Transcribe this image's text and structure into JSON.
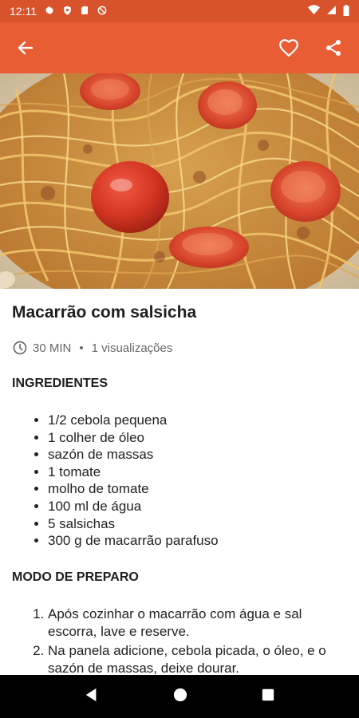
{
  "status_bar": {
    "time": "12:11",
    "icons": [
      "settings-icon",
      "shield-icon",
      "sd-card-icon",
      "no-sync-icon",
      "wifi-icon",
      "signal-icon",
      "battery-icon"
    ]
  },
  "app_bar": {
    "back_icon": "arrow-back-icon",
    "favorite_icon": "heart-outline-icon",
    "share_icon": "share-icon",
    "background": "#e95d35"
  },
  "recipe": {
    "title": "Macarrão com salsicha",
    "time": "30 MIN",
    "separator": "•",
    "views": "1 visualizações",
    "ingredients_heading": "INGREDIENTES",
    "ingredients": [
      "1/2 cebola pequena",
      "1 colher de óleo",
      "sazón de massas",
      "1 tomate",
      "molho de tomate",
      "100 ml de água",
      "5 salsichas",
      "300 g de macarrão parafuso"
    ],
    "method_heading": "MODO DE PREPARO",
    "steps": [
      "Após cozinhar o macarrão com água e sal escorra, lave e reserve.",
      "Na panela adicione, cebola picada, o óleo, e o sazón de massas, deixe dourar."
    ]
  },
  "nav_bar": {
    "back": "nav-back-icon",
    "home": "nav-home-icon",
    "recents": "nav-recents-icon"
  }
}
